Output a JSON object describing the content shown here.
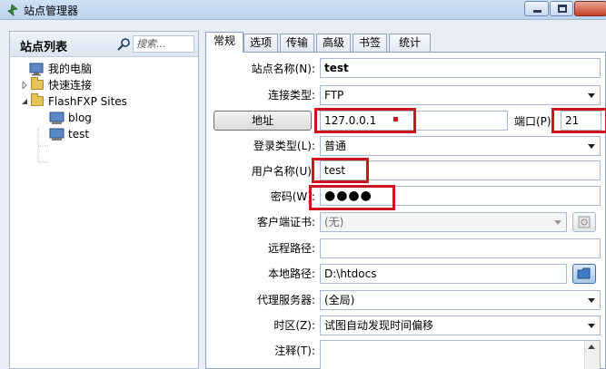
{
  "window": {
    "title": "站点管理器"
  },
  "sidebar": {
    "title": "站点列表",
    "search_placeholder": "搜索...",
    "tree": [
      {
        "label": "我的电脑",
        "icon": "computer-icon"
      },
      {
        "label": "快速连接",
        "icon": "folder-icon"
      },
      {
        "label": "FlashFXP Sites",
        "icon": "folder-icon"
      },
      {
        "label": "blog",
        "icon": "site-icon"
      },
      {
        "label": "test",
        "icon": "site-icon"
      }
    ]
  },
  "tabs": [
    "常规",
    "选项",
    "传输",
    "高级",
    "书签",
    "统计"
  ],
  "form": {
    "site_name_label": "站点名称(N):",
    "site_name_value": "test",
    "conn_type_label": "连接类型:",
    "conn_type_value": "FTP",
    "address_button": "地址",
    "address_value": "127.0.0.1",
    "port_label": "端口(P):",
    "port_value": "21",
    "login_type_label": "登录类型(L):",
    "login_type_value": "普通",
    "username_label": "用户名称(U):",
    "username_value": "test",
    "password_label": "密码(W):",
    "password_value": "●●●●",
    "client_cert_label": "客户端证书:",
    "client_cert_value": "(无)",
    "remote_path_label": "远程路径:",
    "remote_path_value": "",
    "local_path_label": "本地路径:",
    "local_path_value": "D:\\htdocs",
    "proxy_label": "代理服务器:",
    "proxy_value": "(全局)",
    "timezone_label": "时区(Z):",
    "timezone_value": "试图自动发现时间偏移",
    "notes_label": "注释(T):",
    "notes_value": ""
  },
  "colors": {
    "highlight": "#cc1420",
    "accent": "#5a87c6"
  }
}
